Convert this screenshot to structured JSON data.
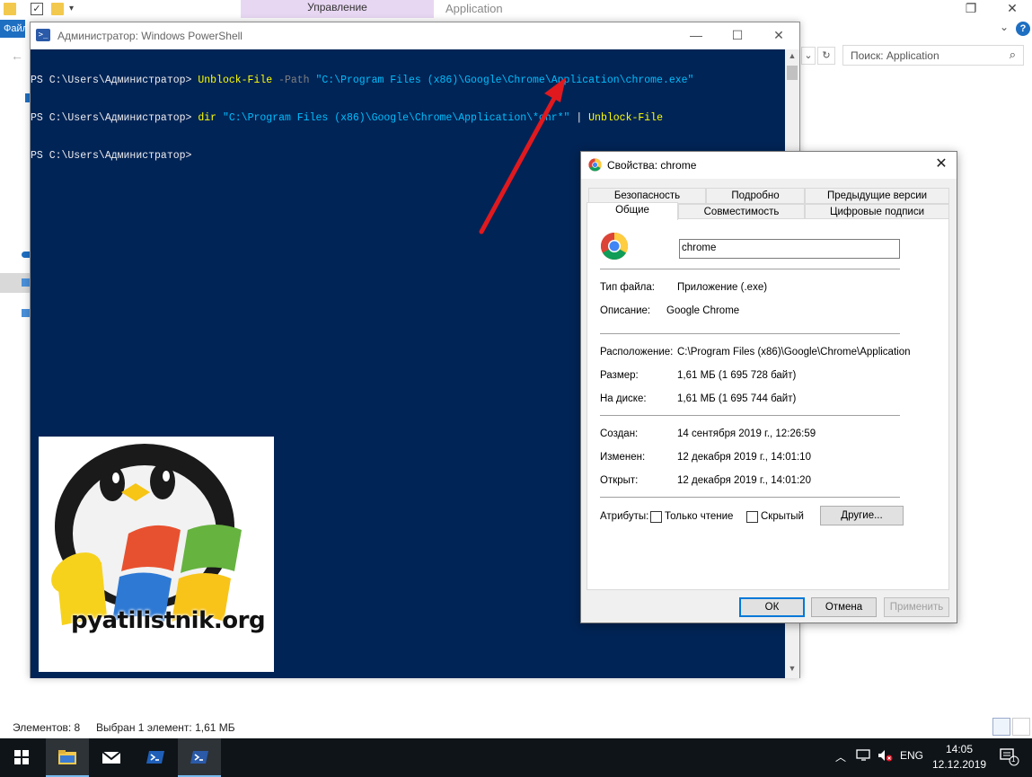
{
  "explorer": {
    "ribbon_manage_tab": "Управление",
    "ribbon_app_tab": "Application",
    "file_tab": "Файл",
    "search_placeholder": "Поиск: Application",
    "status_items": "Элементов: 8",
    "status_selected": "Выбран 1 элемент: 1,61 МБ"
  },
  "powershell": {
    "title": "Администратор: Windows PowerShell",
    "lines": [
      {
        "prompt": "PS C:\\Users\\Администратор> ",
        "cmd": "Unblock-File",
        "param": " -Path ",
        "str": "\"C:\\Program Files (x86)\\Google\\Chrome\\Application\\chrome.exe\"",
        "pipe": "",
        "cmd2": ""
      },
      {
        "prompt": "PS C:\\Users\\Администратор> ",
        "cmd": "dir",
        "param": " ",
        "str": "\"C:\\Program Files (x86)\\Google\\Chrome\\Application\\*chr*\"",
        "pipe": " | ",
        "cmd2": "Unblock-File"
      },
      {
        "prompt": "PS C:\\Users\\Администратор>",
        "cmd": "",
        "param": "",
        "str": "",
        "pipe": "",
        "cmd2": ""
      }
    ]
  },
  "logo": {
    "text": "pyatilistnik.org"
  },
  "properties": {
    "title": "Свойства: chrome",
    "tabs_row1": [
      "Безопасность",
      "Подробно",
      "Предыдущие версии"
    ],
    "tabs_row2": [
      "Общие",
      "Совместимость",
      "Цифровые подписи"
    ],
    "file_name": "chrome",
    "file_type_label": "Тип файла:",
    "file_type_value": "Приложение (.exe)",
    "description_label": "Описание:",
    "description_value": "Google Chrome",
    "location_label": "Расположение:",
    "location_value": "C:\\Program Files (x86)\\Google\\Chrome\\Application",
    "size_label": "Размер:",
    "size_value": "1,61 МБ (1 695 728 байт)",
    "disk_label": "На диске:",
    "disk_value": "1,61 МБ (1 695 744 байт)",
    "created_label": "Создан:",
    "created_value": "14 сентября 2019 г., 12:26:59",
    "modified_label": "Изменен:",
    "modified_value": "12 декабря 2019 г., 14:01:10",
    "opened_label": "Открыт:",
    "opened_value": "12 декабря 2019 г., 14:01:20",
    "attributes_label": "Атрибуты:",
    "readonly_label": "Только чтение",
    "hidden_label": "Скрытый",
    "other_button": "Другие...",
    "ok_button": "ОК",
    "cancel_button": "Отмена",
    "apply_button": "Применить"
  },
  "taskbar": {
    "language": "ENG",
    "time": "14:05",
    "date": "12.12.2019",
    "notification_count": "1"
  },
  "colors": {
    "console_bg": "#012456",
    "console_cmd": "#ffff00",
    "console_string": "#00bfff",
    "console_param": "#808080",
    "accent": "#0078d7",
    "annotation_arrow": "#e0191e"
  }
}
